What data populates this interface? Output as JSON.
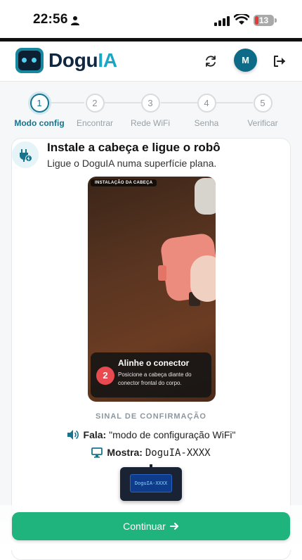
{
  "status_bar": {
    "time": "22:56",
    "battery_level": "13"
  },
  "header": {
    "brand_prefix": "Dogu",
    "brand_suffix": "IA",
    "avatar_initial": "M"
  },
  "stepper": {
    "steps": [
      {
        "number": "1",
        "label": "Modo config",
        "active": true
      },
      {
        "number": "2",
        "label": "Encontrar",
        "active": false
      },
      {
        "number": "3",
        "label": "Rede WiFi",
        "active": false
      },
      {
        "number": "4",
        "label": "Senha",
        "active": false
      },
      {
        "number": "5",
        "label": "Verificar",
        "active": false
      }
    ]
  },
  "card": {
    "title": "Instale a cabeça e ligue o robô",
    "subtitle": "Ligue o DoguIA numa superfície plana.",
    "video": {
      "tag": "INSTALAÇÃO DA CABEÇA",
      "step_number": "2",
      "caption_title": "Alinhe o conector",
      "caption_body": "Posicione a cabeça diante do conector frontal do corpo."
    },
    "signal": {
      "heading": "SINAL DE CONFIRMAÇÃO",
      "speaks_label": "Fala:",
      "speaks_value": "\"modo de configuração WiFi\"",
      "shows_label": "Mostra:",
      "shows_value": "DoguIA-XXXX",
      "screen_text": "DoguIA-XXXX"
    }
  },
  "footer": {
    "continue_label": "Continuar"
  },
  "colors": {
    "accent": "#16748e",
    "brand_ai": "#1aa7c7",
    "cta": "#1fb47e",
    "step_badge": "#e84a4f"
  }
}
